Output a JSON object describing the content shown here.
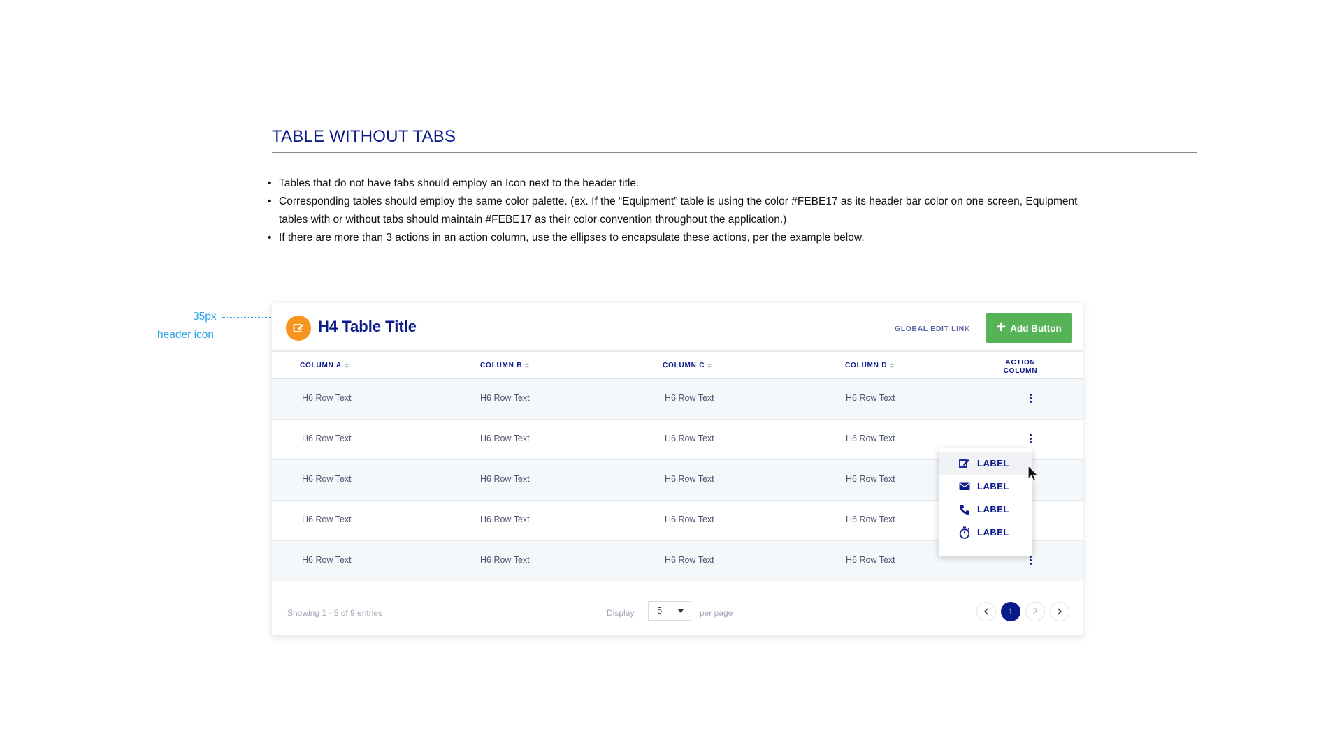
{
  "section": {
    "title": "TABLE WITHOUT TABS",
    "bullets": [
      "Tables that do not have tabs should employ an Icon next to the header title.",
      "Corresponding tables should employ the same color palette. (ex. If the “Equipment” table is using the color #FEBE17 as its header bar color on one screen, Equipment tables with or without tabs should maintain  #FEBE17 as their color convention throughout the application.)",
      "If there are more than 3 actions in an action column, use the ellipses to encapsulate these actions, per the example below."
    ]
  },
  "annotations": {
    "size_label": "35px",
    "icon_label": "header icon",
    "color": "#2aa3e8"
  },
  "table": {
    "title": "H4 Table Title",
    "header_icon": "edit-icon",
    "header_icon_color": "#f7941d",
    "global_edit_link": "GLOBAL EDIT LINK",
    "add_button": "Add Button",
    "add_button_color": "#56b356",
    "columns": [
      "COLUMN A",
      "COLUMN B",
      "COLUMN C",
      "COLUMN D"
    ],
    "action_column": [
      "ACTION",
      "COLUMN"
    ],
    "rows": [
      [
        "H6 Row Text",
        "H6 Row Text",
        "H6 Row Text",
        "H6 Row Text"
      ],
      [
        "H6 Row Text",
        "H6 Row Text",
        "H6 Row Text",
        "H6 Row Text"
      ],
      [
        "H6 Row Text",
        "H6 Row Text",
        "H6 Row Text",
        "H6 Row Text"
      ],
      [
        "H6 Row Text",
        "H6 Row Text",
        "H6 Row Text",
        "H6 Row Text"
      ],
      [
        "H6 Row Text",
        "H6 Row Text",
        "H6 Row Text",
        "H6 Row Text"
      ]
    ],
    "action_menu": [
      {
        "icon": "edit-icon",
        "label": "LABEL"
      },
      {
        "icon": "envelope-icon",
        "label": "LABEL"
      },
      {
        "icon": "phone-icon",
        "label": "LABEL"
      },
      {
        "icon": "stopwatch-icon",
        "label": "LABEL"
      }
    ],
    "footer": {
      "showing": "Showing 1 - 5 of 9 entries",
      "display_label": "Display",
      "per_page_value": "5",
      "per_page_label": "per page",
      "pages": [
        "1",
        "2"
      ],
      "current_page": "1"
    }
  },
  "colors": {
    "primary": "#0b1a8a",
    "row_alt": "#f5f8fb"
  }
}
